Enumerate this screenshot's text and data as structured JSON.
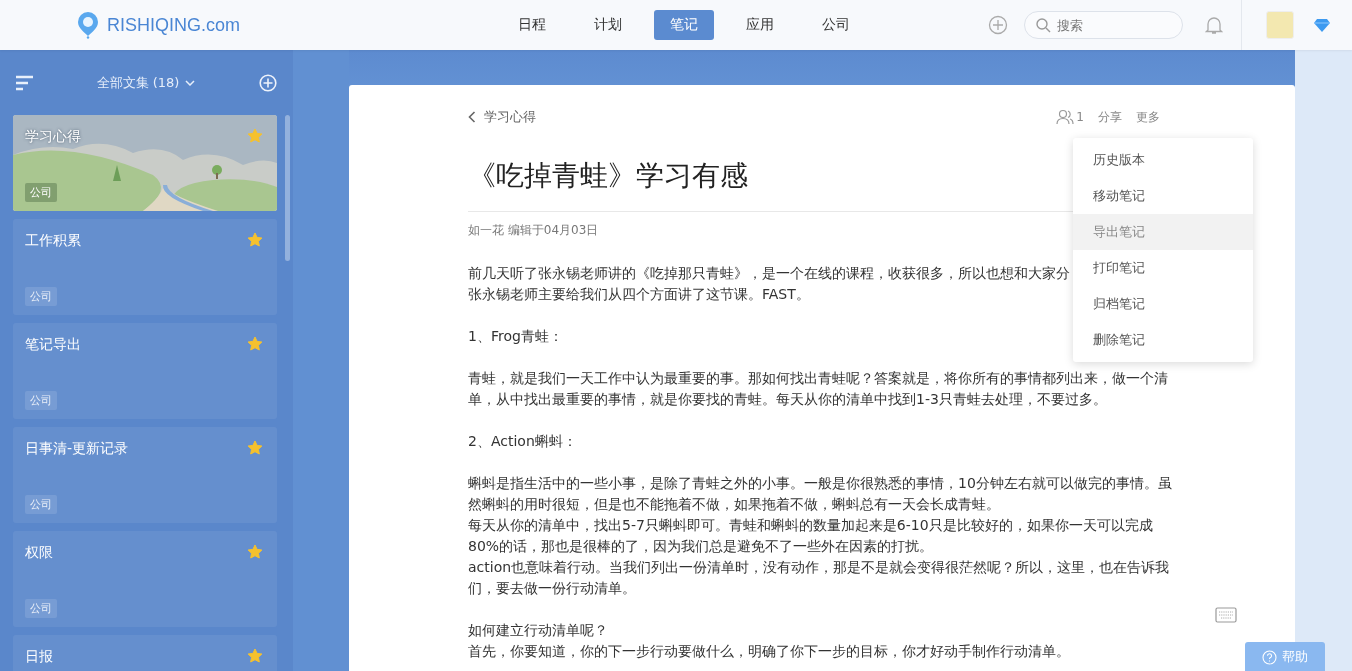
{
  "header": {
    "logo": "RISHIQING.com",
    "nav": [
      {
        "label": "日程",
        "selected": false
      },
      {
        "label": "计划",
        "selected": false
      },
      {
        "label": "笔记",
        "selected": true
      },
      {
        "label": "应用",
        "selected": false
      },
      {
        "label": "公司",
        "selected": false
      }
    ],
    "search": {
      "placeholder": "搜索"
    }
  },
  "sidebar": {
    "title": "全部文集 (18)",
    "notebooks": [
      {
        "title": "学习心得",
        "tag": "公司",
        "starred": true,
        "selected": true
      },
      {
        "title": "工作积累",
        "tag": "公司",
        "starred": true,
        "selected": false
      },
      {
        "title": "笔记导出",
        "tag": "公司",
        "starred": true,
        "selected": false
      },
      {
        "title": "日事清-更新记录",
        "tag": "公司",
        "starred": true,
        "selected": false
      },
      {
        "title": "权限",
        "tag": "公司",
        "starred": true,
        "selected": false
      },
      {
        "title": "日报",
        "starred": true,
        "selected": false
      }
    ]
  },
  "document": {
    "breadcrumb": "学习心得",
    "collaborators": "1",
    "actions": [
      "分享",
      "更多"
    ],
    "title": "《吃掉青蛙》学习有感",
    "meta": "如一花 编辑于04月03日",
    "body": [
      {
        "paragraphs": [
          "前几天听了张永锡老师讲的《吃掉那只青蛙》，是一个在线的课程，收获很多，所以也想和大家分",
          "张永锡老师主要给我们从四个方面讲了这节课。FAST。"
        ]
      },
      {
        "paragraphs": [
          "1、Frog青蛙："
        ]
      },
      {
        "paragraphs": [
          "青蛙，就是我们一天工作中认为最重要的事。那如何找出青蛙呢？答案就是，将你所有的事情都列出来，做一个清单，从中找出最重要的事情，就是你要找的青蛙。每天从你的清单中找到1-3只青蛙去处理，不要过多。"
        ]
      },
      {
        "paragraphs": [
          "2、Action蝌蚪："
        ]
      },
      {
        "paragraphs": [
          "蝌蚪是指生活中的一些小事，是除了青蛙之外的小事。一般是你很熟悉的事情，10分钟左右就可以做完的事情。虽然蝌蚪的用时很短，但是也不能拖着不做，如果拖着不做，蝌蚪总有一天会长成青蛙。",
          "每天从你的清单中，找出5-7只蝌蚪即可。青蛙和蝌蚪的数量加起来是6-10只是比较好的，如果你一天可以完成80%的话，那也是很棒的了，因为我们总是避免不了一些外在因素的打扰。",
          "action也意味着行动。当我们列出一份清单时，没有动作，那是不是就会变得很茫然呢？所以，这里，也在告诉我们，要去做一份行动清单。"
        ]
      },
      {
        "paragraphs": [
          "如何建立行动清单呢？",
          "首先，你要知道，你的下一步行动要做什么，明确了你下一步的目标，你才好动手制作行动清单。"
        ]
      }
    ]
  },
  "more_menu": {
    "items": [
      {
        "label": "历史版本",
        "selected": false
      },
      {
        "label": "移动笔记",
        "selected": false
      },
      {
        "label": "导出笔记",
        "selected": true
      },
      {
        "label": "打印笔记",
        "selected": false
      },
      {
        "label": "归档笔记",
        "selected": false
      },
      {
        "label": "删除笔记",
        "selected": false
      }
    ]
  },
  "help_button": "帮助"
}
